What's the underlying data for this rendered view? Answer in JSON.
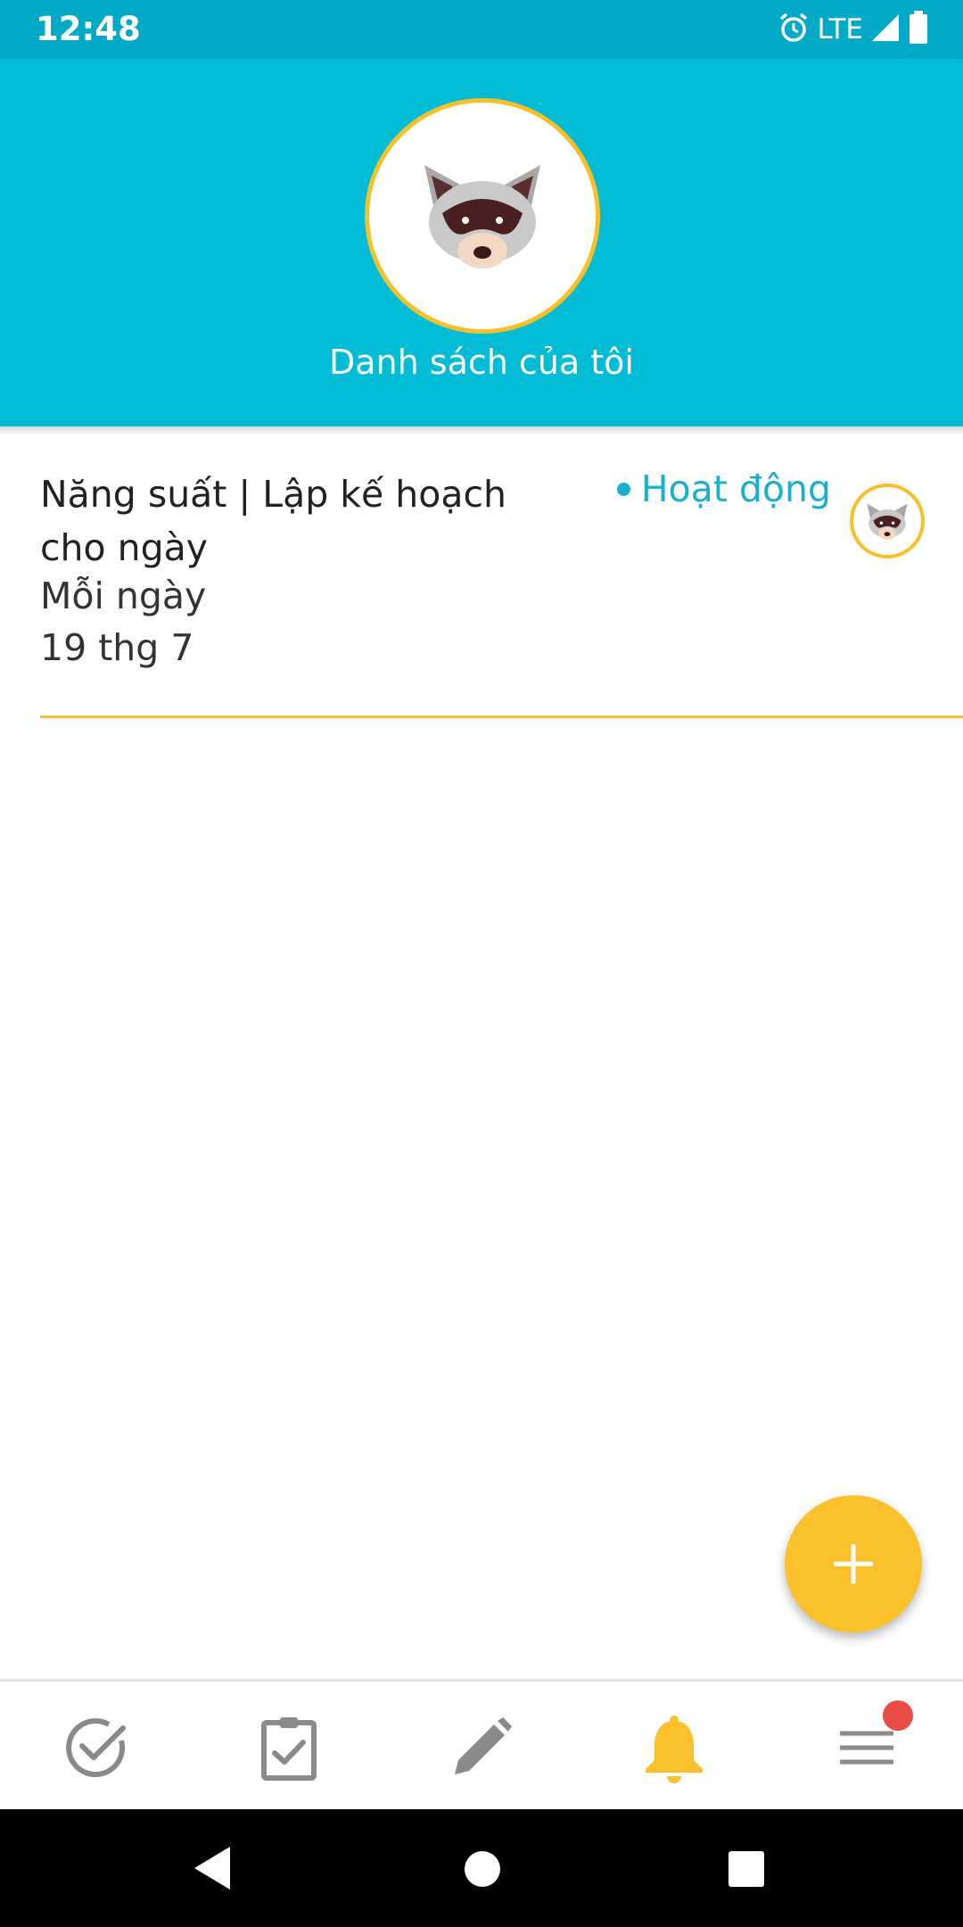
{
  "status_bar": {
    "time": "12:48",
    "network": "LTE",
    "icons": [
      "alarm-icon",
      "signal-icon",
      "battery-icon"
    ]
  },
  "header": {
    "avatar_icon": "raccoon-icon",
    "title": "Danh sách của tôi"
  },
  "list": {
    "items": [
      {
        "title": "Năng suất | Lập kế hoạch cho ngày",
        "frequency": "Mỗi ngày",
        "date": "19 thg 7",
        "status": "Hoạt động",
        "avatar_icon": "raccoon-icon"
      }
    ]
  },
  "fab": {
    "icon": "plus-icon"
  },
  "bottom_nav": {
    "items": [
      {
        "icon": "check-circle-icon",
        "active": false
      },
      {
        "icon": "clipboard-check-icon",
        "active": false
      },
      {
        "icon": "pencil-icon",
        "active": false
      },
      {
        "icon": "bell-icon",
        "active": true
      },
      {
        "icon": "menu-icon",
        "active": false,
        "badge": true
      }
    ]
  },
  "system_nav": {
    "icons": [
      "back-icon",
      "home-icon",
      "recents-icon"
    ]
  },
  "colors": {
    "primary": "#00bcd5",
    "status_bar": "#00a9c5",
    "accent": "#f7c02a",
    "status_text": "#1ab0cc",
    "badge": "#e94b45"
  }
}
